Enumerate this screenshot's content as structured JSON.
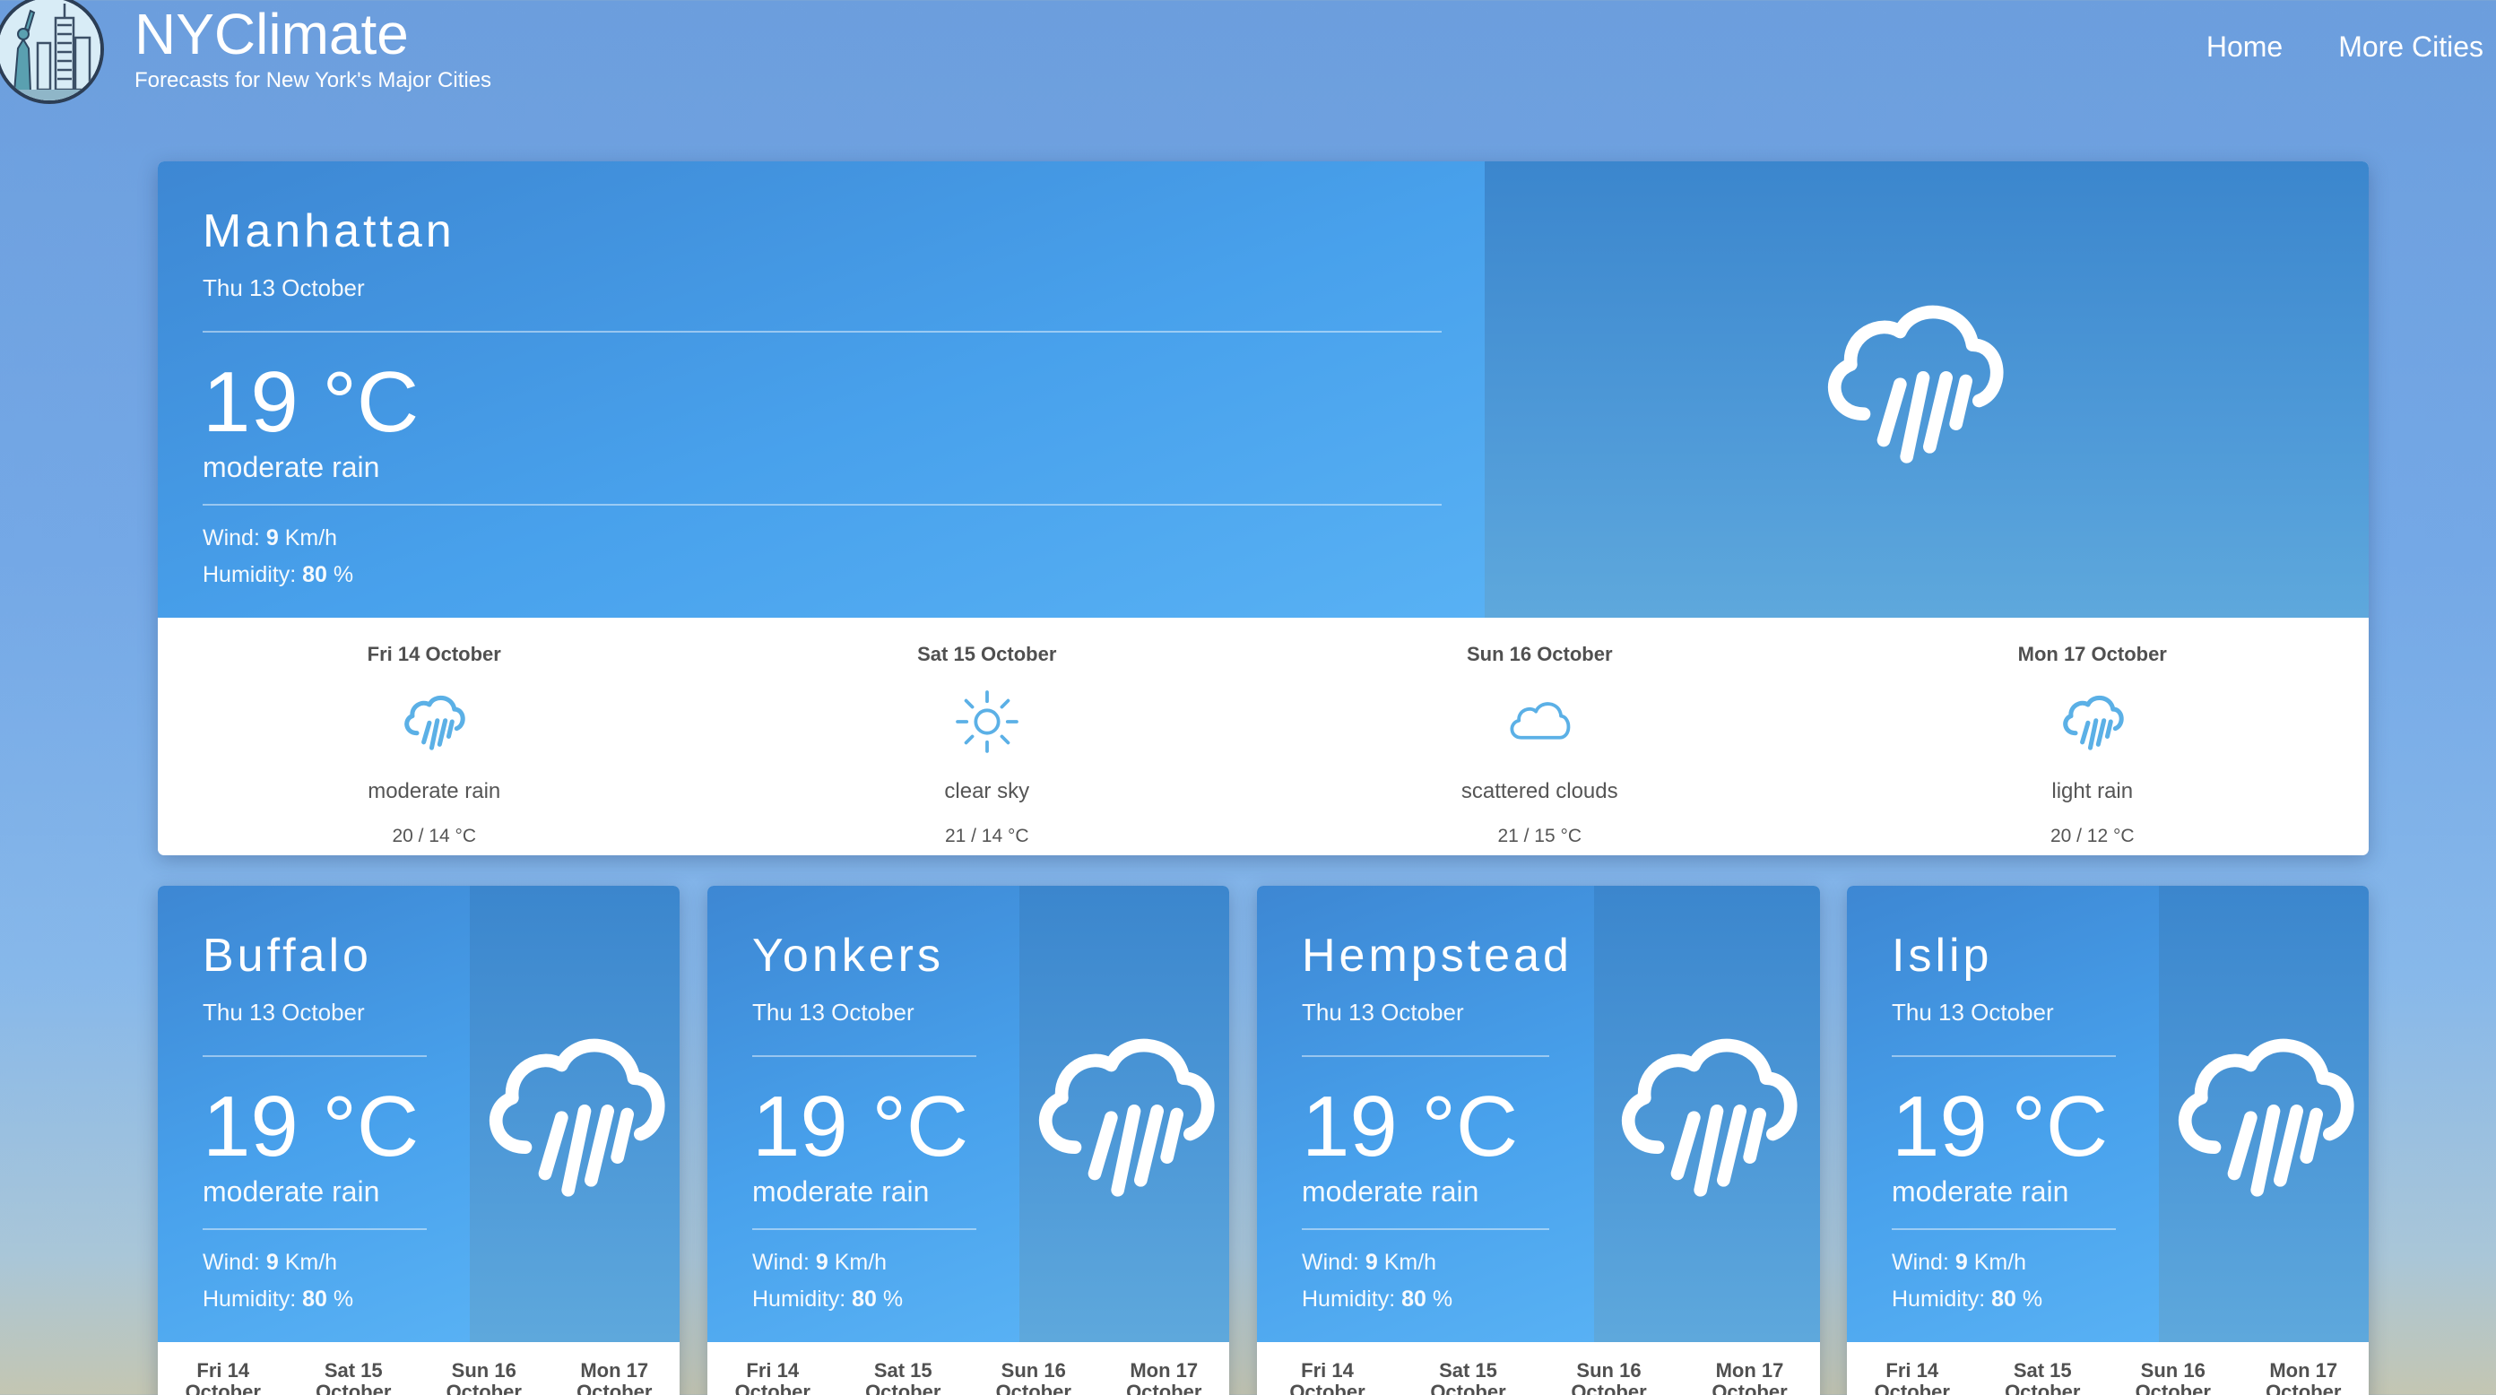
{
  "header": {
    "logo_icon": "statue-of-liberty-skyline-icon",
    "title": "NYClimate",
    "subtitle": "Forecasts for New York's Major Cities",
    "nav": [
      "Home",
      "More Cities"
    ]
  },
  "labels": {
    "wind": "Wind:",
    "humidity": "Humidity:"
  },
  "featured": {
    "city": "Manhattan",
    "date": "Thu 13 October",
    "temp": "19 °C",
    "condition": "moderate rain",
    "wind_value": "9",
    "wind_unit": " Km/h",
    "humidity_value": "80",
    "humidity_unit": " %",
    "icon": "cloud-rain-icon",
    "forecast": [
      {
        "day": "Fri 14 October",
        "icon": "cloud-rain-icon",
        "desc": "moderate rain",
        "temp": "20 / 14 °C"
      },
      {
        "day": "Sat 15 October",
        "icon": "sun-icon",
        "desc": "clear sky",
        "temp": "21 / 14 °C"
      },
      {
        "day": "Sun 16 October",
        "icon": "cloud-icon",
        "desc": "scattered clouds",
        "temp": "21 / 15 °C"
      },
      {
        "day": "Mon 17 October",
        "icon": "cloud-rain-icon",
        "desc": "light rain",
        "temp": "20 / 12 °C"
      }
    ]
  },
  "cities": [
    {
      "city": "Buffalo",
      "date": "Thu 13 October",
      "temp": "19 °C",
      "condition": "moderate rain",
      "wind_value": "9",
      "wind_unit": " Km/h",
      "humidity_value": "80",
      "humidity_unit": " %",
      "icon": "cloud-rain-icon",
      "forecast": [
        [
          "Fri 14",
          "October"
        ],
        [
          "Sat 15",
          "October"
        ],
        [
          "Sun 16",
          "October"
        ],
        [
          "Mon 17",
          "October"
        ]
      ]
    },
    {
      "city": "Yonkers",
      "date": "Thu 13 October",
      "temp": "19 °C",
      "condition": "moderate rain",
      "wind_value": "9",
      "wind_unit": " Km/h",
      "humidity_value": "80",
      "humidity_unit": " %",
      "icon": "cloud-rain-icon",
      "forecast": [
        [
          "Fri 14",
          "October"
        ],
        [
          "Sat 15",
          "October"
        ],
        [
          "Sun 16",
          "October"
        ],
        [
          "Mon 17",
          "October"
        ]
      ]
    },
    {
      "city": "Hempstead",
      "date": "Thu 13 October",
      "temp": "19 °C",
      "condition": "moderate rain",
      "wind_value": "9",
      "wind_unit": " Km/h",
      "humidity_value": "80",
      "humidity_unit": " %",
      "icon": "cloud-rain-icon",
      "forecast": [
        [
          "Fri 14",
          "October"
        ],
        [
          "Sat 15",
          "October"
        ],
        [
          "Sun 16",
          "October"
        ],
        [
          "Mon 17",
          "October"
        ]
      ]
    },
    {
      "city": "Islip",
      "date": "Thu 13 October",
      "temp": "19 °C",
      "condition": "moderate rain",
      "wind_value": "9",
      "wind_unit": " Km/h",
      "humidity_value": "80",
      "humidity_unit": " %",
      "icon": "cloud-rain-icon",
      "forecast": [
        [
          "Fri 14",
          "October"
        ],
        [
          "Sat 15",
          "October"
        ],
        [
          "Sun 16",
          "October"
        ],
        [
          "Mon 17",
          "October"
        ]
      ]
    }
  ]
}
